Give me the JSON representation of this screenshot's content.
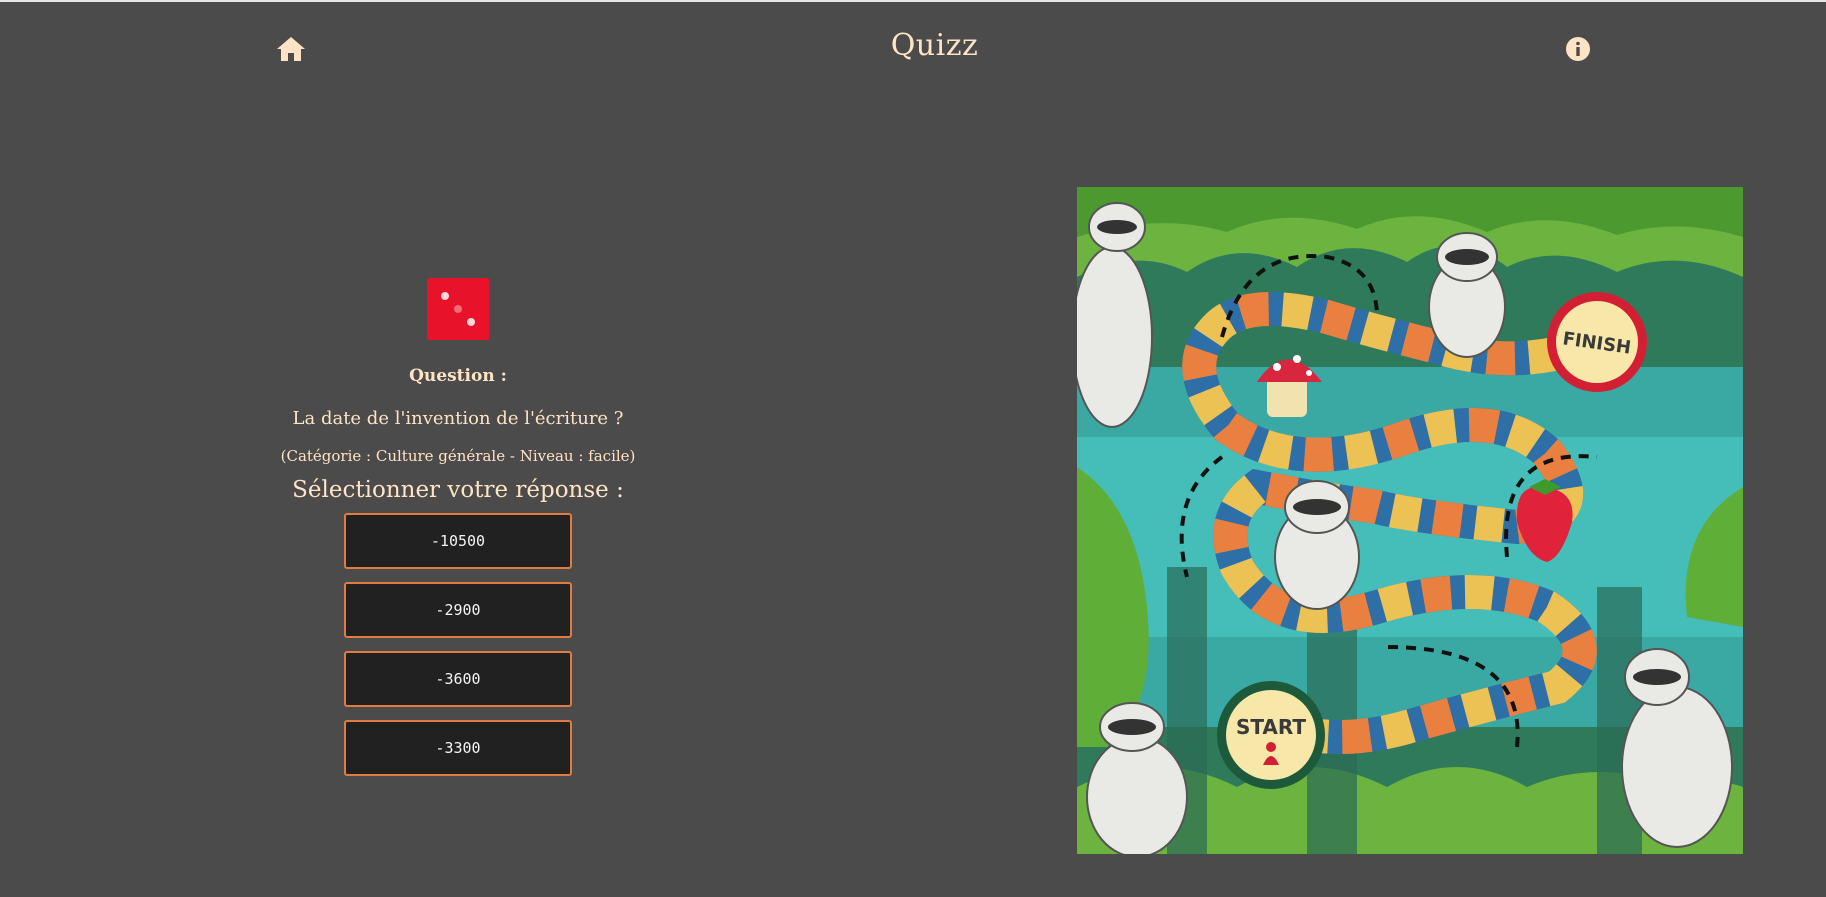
{
  "header": {
    "title": "Quizz",
    "home_icon": "home-icon",
    "info_icon": "info-icon"
  },
  "quiz": {
    "dice_icon": "dice-icon",
    "dice_value": 3,
    "question_label": "Question :",
    "question_text": "La date de l'invention de l'écriture ?",
    "category_text": "(Catégorie : Culture générale - Niveau : facile)",
    "select_prompt": "Sélectionner votre réponse :",
    "answers": [
      "-10500",
      "-2900",
      "-3600",
      "-3300"
    ]
  },
  "board": {
    "start_label": "START",
    "finish_label": "FINISH"
  },
  "colors": {
    "background": "#4b4b4b",
    "accent_text": "#ffe3c4",
    "answer_border": "#e07b41",
    "answer_bg": "#212121",
    "dice": "#e8132a"
  }
}
